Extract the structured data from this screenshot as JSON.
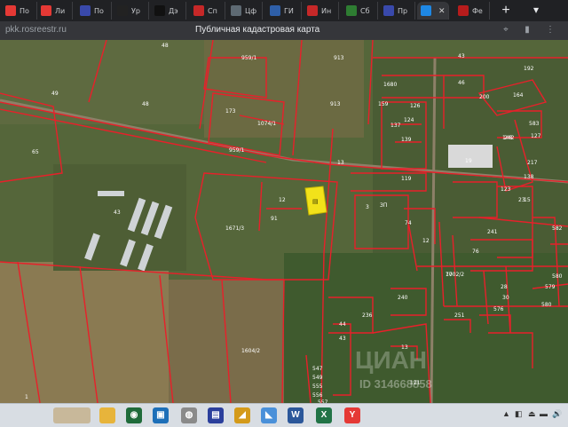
{
  "browser": {
    "tabs": [
      {
        "label": "По",
        "color": "#e53935"
      },
      {
        "label": "Ли",
        "color": "#e53935"
      },
      {
        "label": "По",
        "color": "#3949ab"
      },
      {
        "label": "Ур",
        "color": "#222222"
      },
      {
        "label": "Дэ",
        "color": "#111111"
      },
      {
        "label": "Сп",
        "color": "#c62828"
      },
      {
        "label": "Цф",
        "color": "#5e6a73"
      },
      {
        "label": "ГИ",
        "color": "#2e5fa8"
      },
      {
        "label": "Ин",
        "color": "#c62828"
      },
      {
        "label": "Сб",
        "color": "#2e7d32"
      },
      {
        "label": "Пр",
        "color": "#3949ab"
      },
      {
        "label": "Б",
        "color": "#1e88e5",
        "active": true
      },
      {
        "label": "Фе",
        "color": "#b71c1c"
      }
    ],
    "new_tab": "+",
    "menu_glyph": "▾",
    "close_glyph": "✕",
    "url": "pkk.rosreestr.ru",
    "page_title": "Публичная кадастровая карта",
    "icons": [
      "location-icon",
      "bookmark-icon",
      "menu-icon"
    ]
  },
  "map": {
    "labels": [
      "48",
      "959/1",
      "913",
      "43",
      "192",
      "1680",
      "46",
      "200",
      "164",
      "49",
      "48",
      "173",
      "1074/1",
      "913",
      "159",
      "126",
      "124",
      "137",
      "583",
      "127",
      "148",
      "242",
      "217",
      "139",
      "19",
      "138",
      "65",
      "959/1",
      "13",
      "119",
      "123",
      "15",
      "43",
      "12",
      "91",
      "3",
      "ЗП",
      "74",
      "1671/3",
      "241",
      "582",
      "580",
      "579",
      "12",
      "23",
      "76",
      "70",
      "1702/2",
      "580",
      "28",
      "30",
      "576",
      "240",
      "236",
      "251",
      "44",
      "43",
      "1604/2",
      "13",
      "547",
      "549",
      "555",
      "556",
      "557",
      "121",
      "1"
    ],
    "watermark": "ЦИАН",
    "watermark_id": "ID 314668858",
    "colors": {
      "boundary": "#e8202a",
      "highlight": "#f2e21a"
    }
  },
  "taskbar": {
    "items": [
      {
        "name": "start-app-icon",
        "color": "#c8b89a",
        "glyph": ""
      },
      {
        "name": "file-explorer-icon",
        "color": "#e7b43b",
        "glyph": ""
      },
      {
        "name": "browser-green-icon",
        "color": "#1f6b3a",
        "glyph": "◉"
      },
      {
        "name": "display-icon",
        "color": "#1d6fb8",
        "glyph": "▣"
      },
      {
        "name": "manager-icon",
        "color": "#8a8a8a",
        "glyph": "◍"
      },
      {
        "name": "save-icon",
        "color": "#2b3f9c",
        "glyph": "▤"
      },
      {
        "name": "draw-icon",
        "color": "#d49a1a",
        "glyph": "◢"
      },
      {
        "name": "weather-icon",
        "color": "#4a90d9",
        "glyph": "◣"
      },
      {
        "name": "word-icon",
        "color": "#2b579a",
        "glyph": "W"
      },
      {
        "name": "excel-icon",
        "color": "#217346",
        "glyph": "X"
      },
      {
        "name": "yandex-browser-icon",
        "color": "#e53935",
        "glyph": "Y"
      }
    ],
    "tray": [
      "▲",
      "◧",
      "⏏",
      "▬",
      "🔊"
    ]
  }
}
